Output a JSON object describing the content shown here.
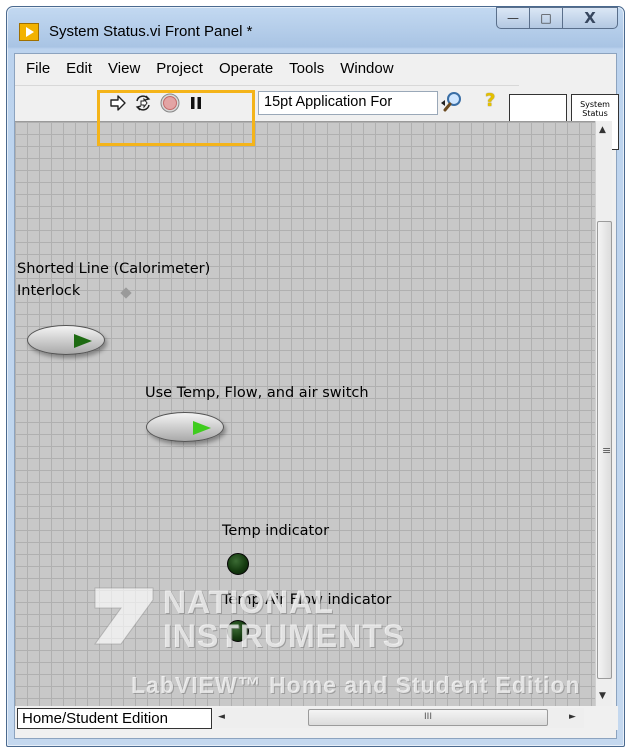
{
  "window": {
    "title": "System Status.vi Front Panel *",
    "controls": {
      "minimize": "—",
      "maximize": "□",
      "close": "X"
    }
  },
  "menu": [
    "File",
    "Edit",
    "View",
    "Project",
    "Operate",
    "Tools",
    "Window"
  ],
  "toolbar": {
    "run_icon": "run-arrow-icon",
    "run_continuous_icon": "run-continuously-icon",
    "abort_icon": "abort-stop-icon",
    "pause_icon": "pause-icon",
    "font_select": "15pt Application For",
    "search_icon": "search-icon",
    "help_icon": "help-icon",
    "help_glyph": "?"
  },
  "vi_icon_text": [
    "System",
    "Status"
  ],
  "front_panel": {
    "controls": [
      {
        "label": "Shorted Line (Calorimeter)",
        "label2": "Interlock",
        "type": "switch",
        "state": "off"
      },
      {
        "label": "Use Temp, Flow, and air switch",
        "type": "switch",
        "state": "on"
      }
    ],
    "indicators": [
      {
        "label": "Temp indicator",
        "type": "led",
        "state": "off"
      },
      {
        "label": "Temp Air Flow indicator",
        "type": "led",
        "state": "off"
      }
    ]
  },
  "watermark": {
    "line1": "NATIONAL",
    "line2": "INSTRUMENTS",
    "line3": "LabVIEW™ Home and Student Edition"
  },
  "status_bar": {
    "edition": "Home/Student Edition",
    "hscroll_grip": "III"
  },
  "colors": {
    "highlight": "#f4b41a",
    "panel_grid": "#c8c8c8",
    "switch_on": "#3fcc1e",
    "switch_off": "#1e6b12",
    "led_off": "#153b10"
  }
}
